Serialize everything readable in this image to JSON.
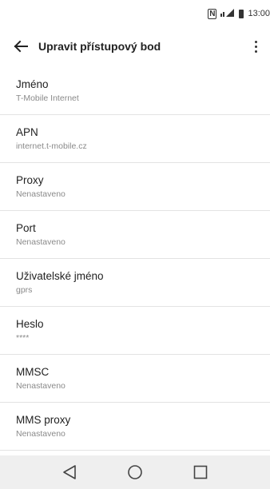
{
  "status_bar": {
    "time": "13:00"
  },
  "app_bar": {
    "title": "Upravit přístupový bod"
  },
  "items": [
    {
      "label": "Jméno",
      "value": "T-Mobile Internet"
    },
    {
      "label": "APN",
      "value": "internet.t-mobile.cz"
    },
    {
      "label": "Proxy",
      "value": "Nenastaveno"
    },
    {
      "label": "Port",
      "value": "Nenastaveno"
    },
    {
      "label": "Uživatelské jméno",
      "value": "gprs"
    },
    {
      "label": "Heslo",
      "value": "****"
    },
    {
      "label": "MMSC",
      "value": "Nenastaveno"
    },
    {
      "label": "MMS proxy",
      "value": "Nenastaveno"
    }
  ]
}
